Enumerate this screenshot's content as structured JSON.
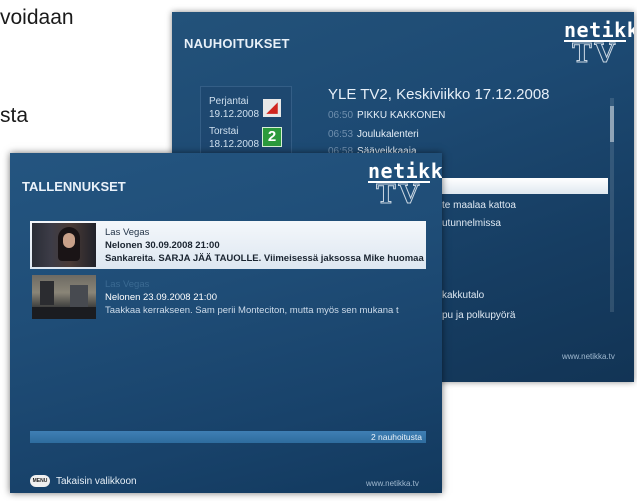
{
  "background_text": {
    "line1": "voidaan",
    "line2": "sta"
  },
  "back_screen": {
    "title": "NAUHOITUKSET",
    "logo": {
      "word": "netikka",
      "tv": "TV"
    },
    "days": [
      {
        "label": "Perjantai",
        "date": "19.12.2008"
      },
      {
        "label": "Torstai",
        "date": "18.12.2008"
      }
    ],
    "day_icons": [
      "yle1",
      "yle2",
      "yle3"
    ],
    "channel_header": "YLE TV2, Keskiviikko 17.12.2008",
    "programs": [
      {
        "time": "06:50",
        "title": "PIKKU KAKKONEN"
      },
      {
        "time": "06:53",
        "title": "Joulukalenteri"
      },
      {
        "time": "06:58",
        "title": "Sääveikkaaja"
      }
    ],
    "partial_items": [
      "te maalaa kattoa",
      "utunnelmissa",
      "kakkutalo",
      "pu ja polkupyörä"
    ],
    "url": "www.netikka.tv"
  },
  "front_screen": {
    "title": "TALLENNUKSET",
    "logo": {
      "word": "netikka",
      "tv": "TV"
    },
    "recordings": [
      {
        "name": "Las Vegas",
        "datetime": "Nelonen 30.09.2008 21:00",
        "description": "Sankareita. SARJA JÄÄ TAUOLLE. Viimeisessä jaksossa Mike huomaa",
        "selected": true
      },
      {
        "name": "Las Vegas",
        "datetime": "Nelonen 23.09.2008 21:00",
        "description": "Taakkaa kerrakseen. Sam perii Monteciton, mutta myös sen mukana t",
        "selected": false
      }
    ],
    "count_label": "2 nauhoitusta",
    "menu_button": "MENU",
    "back_label": "Takaisin valikkoon",
    "url": "www.netikka.tv"
  },
  "colors": {
    "screen_blue": "#1f4d77",
    "selection_white": "#f4f7fb",
    "count_bar": "#3f7fb4",
    "dim_time": "#6f8fae"
  }
}
